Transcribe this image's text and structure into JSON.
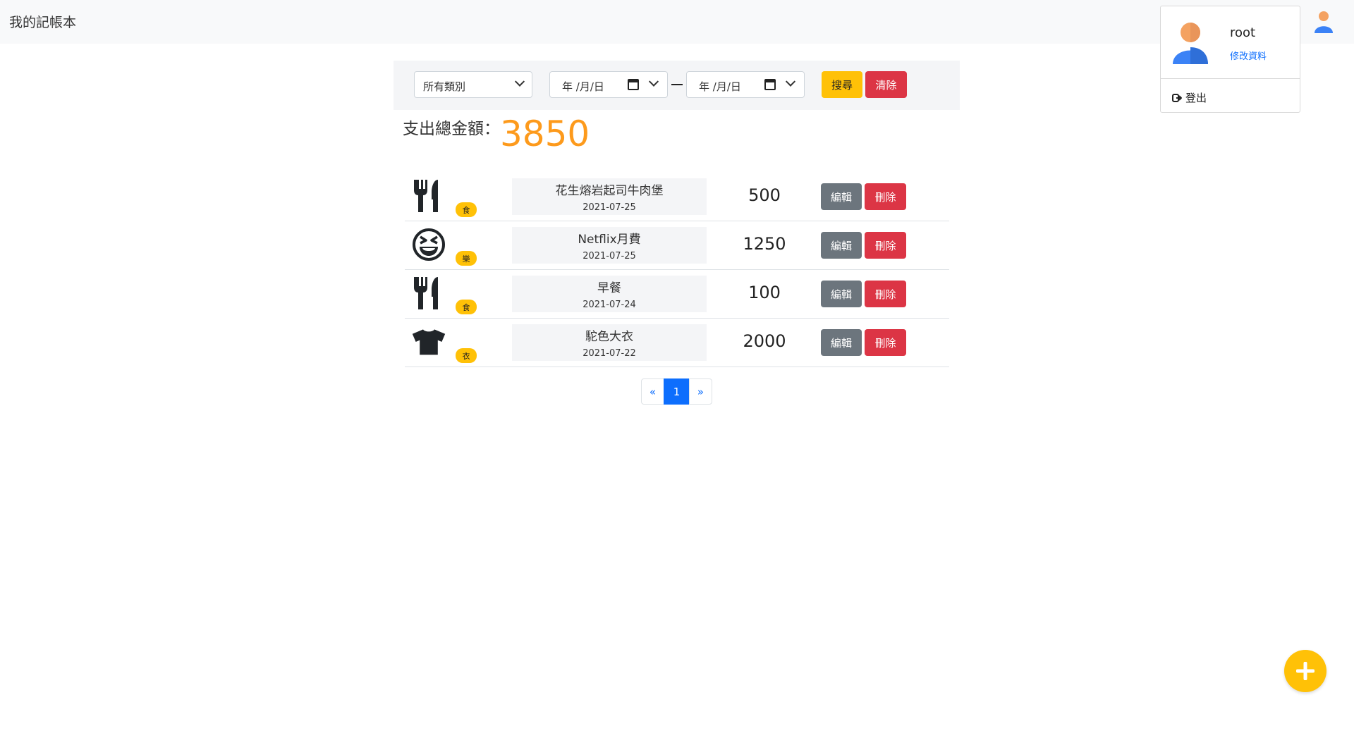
{
  "nav": {
    "brand": "我的記帳本"
  },
  "user_menu": {
    "username": "root",
    "edit_profile": "修改資料",
    "logout": "登出"
  },
  "filter": {
    "category_selected": "所有類別",
    "start_date_placeholder": "年 /月/日",
    "end_date_placeholder": "年 /月/日",
    "search_label": "搜尋",
    "clear_label": "清除"
  },
  "summary": {
    "label": "支出總金額：",
    "total": "3850"
  },
  "records": [
    {
      "icon": "utensils-icon",
      "category": "食",
      "name": "花生熔岩起司牛肉堡",
      "date": "2021-07-25",
      "amount": "500",
      "edit": "編輯",
      "delete": "刪除"
    },
    {
      "icon": "laughing-face-icon",
      "category": "樂",
      "name": "Netflix月費",
      "date": "2021-07-25",
      "amount": "1250",
      "edit": "編輯",
      "delete": "刪除"
    },
    {
      "icon": "utensils-icon",
      "category": "食",
      "name": "早餐",
      "date": "2021-07-24",
      "amount": "100",
      "edit": "編輯",
      "delete": "刪除"
    },
    {
      "icon": "tshirt-icon",
      "category": "衣",
      "name": "駝色大衣",
      "date": "2021-07-22",
      "amount": "2000",
      "edit": "編輯",
      "delete": "刪除"
    }
  ],
  "pagination": {
    "prev": "«",
    "current": "1",
    "next": "»"
  },
  "colors": {
    "accent": "#ffc107",
    "danger": "#dc3545",
    "secondary": "#6c757d",
    "total": "#fd9a1c",
    "primary": "#0d6efd"
  }
}
